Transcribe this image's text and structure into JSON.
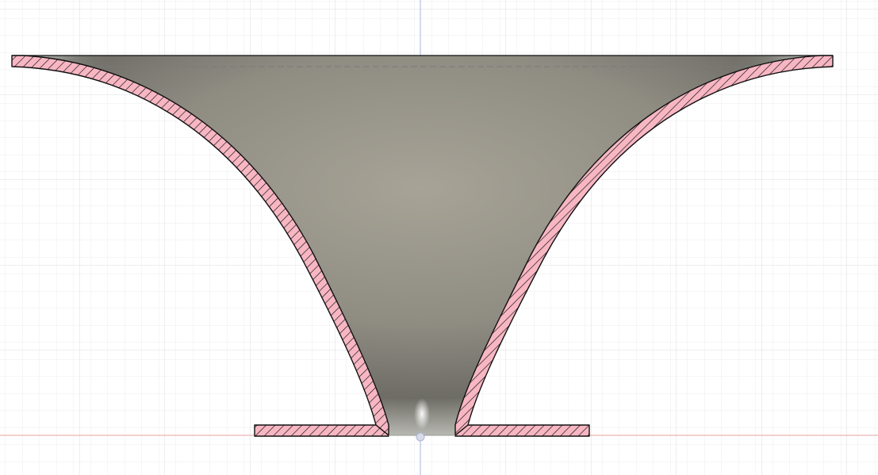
{
  "view": {
    "mode": "section-analysis",
    "background_color": "#ffffff",
    "grid": {
      "visible": true,
      "minor_color": "#eceef1",
      "major_color": "#d9dde2"
    },
    "axes": {
      "horizontal_axis_color": "#e8a0a0",
      "vertical_axis_color": "#a9b4dc"
    }
  },
  "model": {
    "name": "",
    "shape": "flared horn with flat base flange",
    "interior_color": "#a09c90",
    "interior_shadow_color": "#6a6a62",
    "section_fill_color": "#f8b6c3",
    "section_hatch_color": "#1a1a1a",
    "outline_color": "#111111",
    "centerline_color": "#7a7a7a"
  }
}
